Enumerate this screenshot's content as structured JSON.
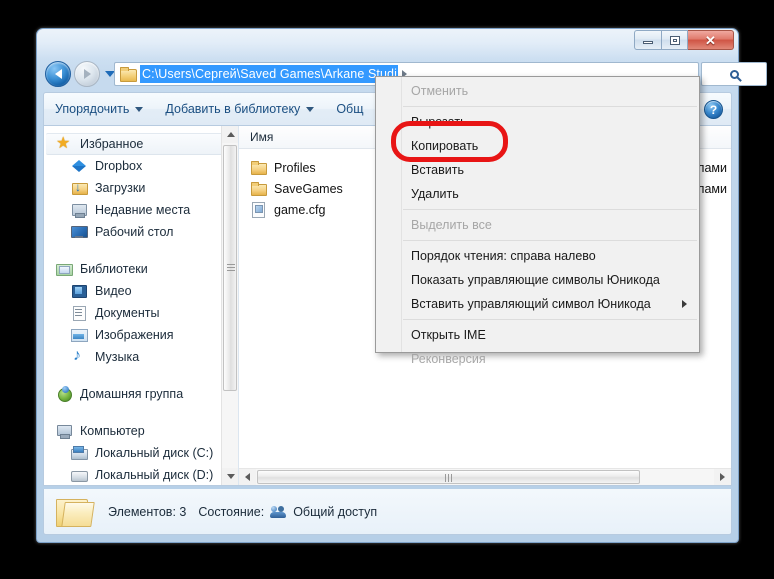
{
  "window": {
    "title": "",
    "buttons": {
      "minimize": "minimize-button",
      "maximize": "maximize-button",
      "close_label": "✕"
    }
  },
  "navbar": {
    "back_tooltip": "Back",
    "forward_tooltip": "Forward",
    "address_value": "C:\\Users\\Сергей\\Saved Games\\Arkane Studi",
    "address_full": "C:\\Users\\Сергей\\Saved Games\\Arkane Studios\\Dishonored",
    "search_placeholder": "",
    "search_icon": "search-icon"
  },
  "commandbar": {
    "items": [
      {
        "label": "Упорядочить",
        "has_caret": true
      },
      {
        "label": "Добавить в библиотеку",
        "has_caret": true
      },
      {
        "label": "Общ",
        "has_caret": false
      }
    ],
    "help_label": "?"
  },
  "sidebar": {
    "groups": [
      {
        "label": "Избранное",
        "icon": "star-icon",
        "selected": true,
        "items": [
          {
            "label": "Dropbox",
            "icon": "dropbox-icon"
          },
          {
            "label": "Загрузки",
            "icon": "downloads-folder-icon"
          },
          {
            "label": "Недавние места",
            "icon": "recent-places-icon"
          },
          {
            "label": "Рабочий стол",
            "icon": "desktop-icon"
          }
        ]
      },
      {
        "label": "Библиотеки",
        "icon": "libraries-icon",
        "selected": false,
        "items": [
          {
            "label": "Видео",
            "icon": "video-icon"
          },
          {
            "label": "Документы",
            "icon": "documents-icon"
          },
          {
            "label": "Изображения",
            "icon": "pictures-icon"
          },
          {
            "label": "Музыка",
            "icon": "music-icon"
          }
        ]
      },
      {
        "label": "Домашняя группа",
        "icon": "homegroup-icon",
        "selected": false,
        "items": []
      },
      {
        "label": "Компьютер",
        "icon": "computer-icon",
        "selected": false,
        "items": [
          {
            "label": "Локальный диск (C:)",
            "icon": "hard-drive-system-icon"
          },
          {
            "label": "Локальный диск (D:)",
            "icon": "hard-drive-icon"
          }
        ]
      }
    ]
  },
  "filelist": {
    "column_header": "Имя",
    "rows": [
      {
        "name": "Profiles",
        "icon": "folder-icon",
        "type": "лами"
      },
      {
        "name": "SaveGames",
        "icon": "folder-icon",
        "type": "лами"
      },
      {
        "name": "game.cfg",
        "icon": "config-file-icon",
        "type": ""
      }
    ]
  },
  "statusbar": {
    "items_label": "Элементов: 3",
    "state_label": "Состояние:",
    "share_label": "Общий доступ",
    "share_icon": "shared-users-icon",
    "folder_icon": "open-folder-icon"
  },
  "context_menu": {
    "items": [
      {
        "label": "Отменить",
        "disabled": true,
        "submenu": false,
        "separator_after": true
      },
      {
        "label": "Вырезать",
        "disabled": false,
        "submenu": false,
        "separator_after": false
      },
      {
        "label": "Копировать",
        "disabled": false,
        "submenu": false,
        "separator_after": false,
        "highlighted": true
      },
      {
        "label": "Вставить",
        "disabled": false,
        "submenu": false,
        "separator_after": false
      },
      {
        "label": "Удалить",
        "disabled": false,
        "submenu": false,
        "separator_after": true
      },
      {
        "label": "Выделить все",
        "disabled": true,
        "submenu": false,
        "separator_after": true
      },
      {
        "label": "Порядок чтения: справа налево",
        "disabled": false,
        "submenu": false,
        "separator_after": false
      },
      {
        "label": "Показать управляющие символы Юникода",
        "disabled": false,
        "submenu": false,
        "separator_after": false
      },
      {
        "label": "Вставить управляющий символ Юникода",
        "disabled": false,
        "submenu": true,
        "separator_after": true
      },
      {
        "label": "Открыть IME",
        "disabled": false,
        "submenu": false,
        "separator_after": false
      },
      {
        "label": "Реконверсия",
        "disabled": true,
        "submenu": false,
        "separator_after": false
      }
    ]
  },
  "annotation": {
    "shape": "rounded-rect",
    "color": "#e81515",
    "target": "Копировать"
  },
  "colors": {
    "desktop_background": "#000000",
    "window_glass": "#bdd4ea",
    "address_selection": "#3399ff",
    "accent_link": "#1b4f82",
    "annotation_red": "#e81515"
  }
}
